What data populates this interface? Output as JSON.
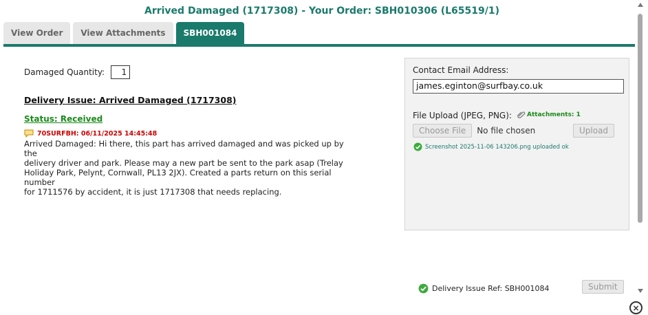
{
  "dialog": {
    "title": "Arrived Damaged (1717308) - Your Order: SBH010306 (L65519/1)"
  },
  "tabs": [
    {
      "label": "View Order",
      "active": false
    },
    {
      "label": "View Attachments",
      "active": false
    },
    {
      "label": "SBH001084",
      "active": true
    }
  ],
  "colors": {
    "accent": "#1a7a6b",
    "status": "#1a8a1a",
    "note_head": "#cc0000"
  },
  "left": {
    "qty_label": "Damaged Quantity:",
    "qty_value": "1",
    "issue_title": "Delivery Issue: Arrived Damaged (1717308)",
    "status": "Status: Received",
    "note": {
      "icon": "speech-bubble-icon",
      "header": "70SURFBH: 06/11/2025 14:45:48",
      "lines": [
        "Arrived Damaged: Hi there, this part has arrived damaged and was picked up by the",
        "delivery driver and park. Please may a new part be sent to the park asap (Trelay",
        "Holiday Park, Pelynt, Cornwall, PL13 2JX). Created a parts return on this serial number",
        "for 1711576 by accident, it is just 1717308 that needs replacing."
      ]
    }
  },
  "panel": {
    "email_label": "Contact Email Address:",
    "email_value": "james.eginton@surfbay.co.uk",
    "upload_label": "File Upload (JPEG, PNG):",
    "attachments": "Attachments: 1",
    "choose_file": "Choose File",
    "no_file": "No file chosen",
    "upload_button": "Upload",
    "uploaded_msg": "Screenshot 2025-11-06 143206.png uploaded ok"
  },
  "footer": {
    "ref": "Delivery Issue Ref: SBH001084",
    "submit": "Submit"
  },
  "close_icon": "close-icon"
}
